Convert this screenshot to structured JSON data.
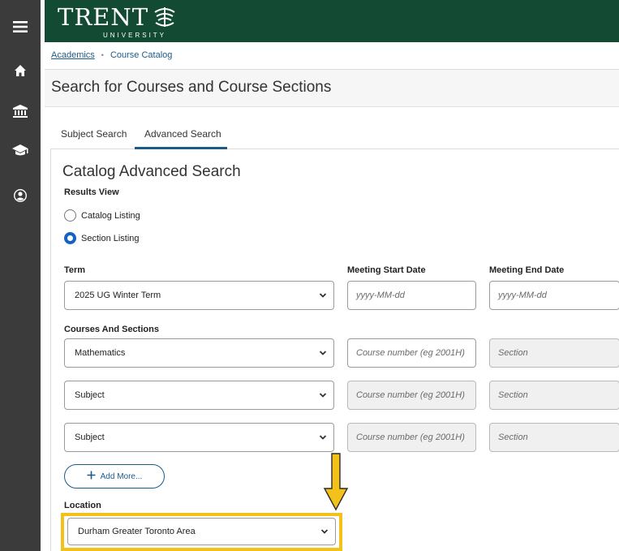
{
  "sidebar": {
    "icons": [
      "menu-icon",
      "home-icon",
      "bank-icon",
      "graduation-cap-icon",
      "user-icon"
    ]
  },
  "brand": {
    "wordmark": "TRENT",
    "sub": "UNIVERSITY",
    "colors": {
      "banner": "#124a33",
      "sidebar": "#3b3b3b",
      "link": "#1a5b8a",
      "highlight": "#f3c21a",
      "arrow": "#f3c21a",
      "radio_selected": "#1363c6"
    }
  },
  "breadcrumb": {
    "items": [
      "Academics",
      "Course Catalog"
    ]
  },
  "page": {
    "title": "Search for Courses and Course Sections"
  },
  "tabs": [
    {
      "label": "Subject Search",
      "active": false
    },
    {
      "label": "Advanced Search",
      "active": true
    }
  ],
  "form": {
    "heading": "Catalog Advanced Search",
    "results_view": {
      "label": "Results View",
      "options": [
        {
          "label": "Catalog Listing",
          "selected": false
        },
        {
          "label": "Section Listing",
          "selected": true
        }
      ]
    },
    "term": {
      "label": "Term",
      "value": "2025 UG Winter Term"
    },
    "meeting_start": {
      "label": "Meeting Start Date",
      "placeholder": "yyyy-MM-dd"
    },
    "meeting_end": {
      "label": "Meeting End Date",
      "placeholder": "yyyy-MM-dd"
    },
    "courses_and_sections": {
      "label": "Courses And Sections",
      "rows": [
        {
          "subject": "Mathematics",
          "course_placeholder": "Course number (eg 2001H)",
          "section_placeholder": "Section"
        },
        {
          "subject": "Subject",
          "course_placeholder": "Course number (eg 2001H)",
          "section_placeholder": "Section"
        },
        {
          "subject": "Subject",
          "course_placeholder": "Course number (eg 2001H)",
          "section_placeholder": "Section"
        }
      ]
    },
    "add_more_label": "Add More...",
    "location": {
      "label": "Location",
      "value": "Durham Greater Toronto Area"
    }
  }
}
